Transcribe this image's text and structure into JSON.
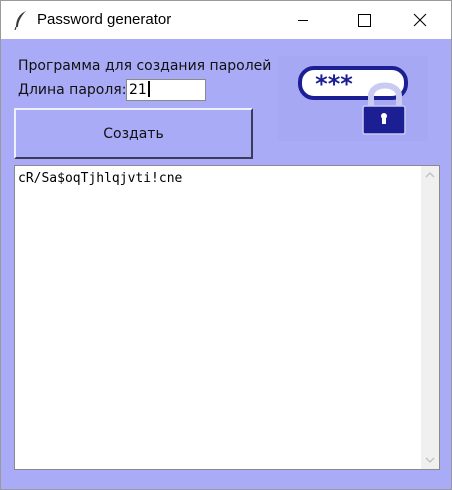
{
  "window": {
    "title": "Password generator",
    "icons": {
      "app": "feather-icon",
      "minimize": "minimize-icon",
      "maximize": "maximize-icon",
      "close": "close-icon"
    }
  },
  "form": {
    "heading": "Программа для создания паролей",
    "length_label": "Длина пароля:",
    "length_value": "21",
    "create_button": "Создать"
  },
  "logo": {
    "icon": "password-lock-icon",
    "text": "***"
  },
  "output": {
    "text": "cR/Sa$oqTjhlqjvti!cne"
  },
  "colors": {
    "background": "#a9abf6",
    "logo_blue": "#1c1f94"
  }
}
